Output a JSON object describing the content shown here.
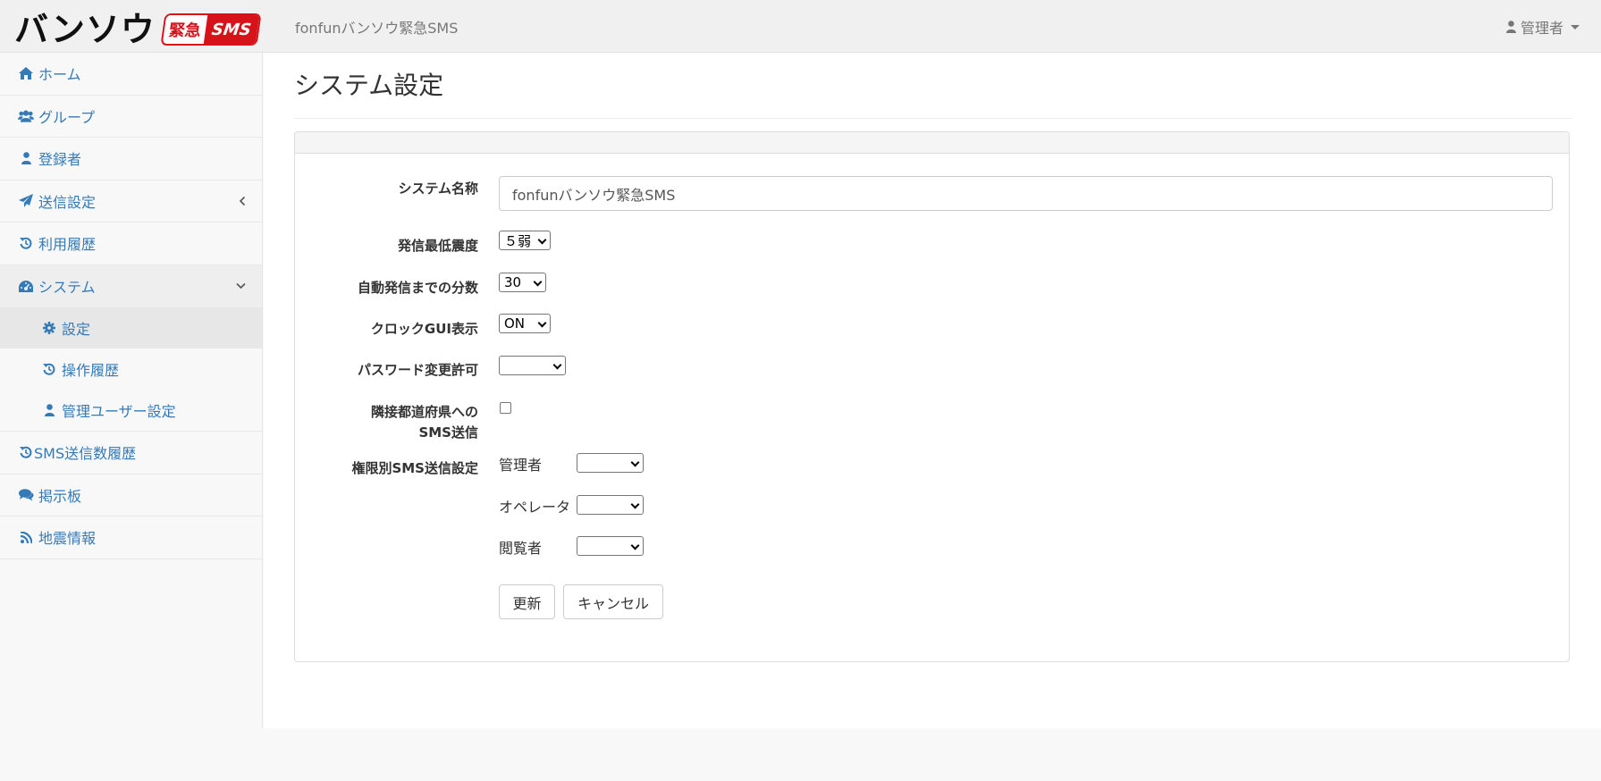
{
  "logo": {
    "text": "バンソウ",
    "badge_kanji": "緊急",
    "badge_sms": "SMS"
  },
  "header": {
    "app_title": "fonfunバンソウ緊急SMS",
    "user_label": "管理者"
  },
  "sidebar": {
    "items": [
      {
        "label": "ホーム",
        "icon": "home-icon"
      },
      {
        "label": "グループ",
        "icon": "users-icon"
      },
      {
        "label": "登録者",
        "icon": "user-icon"
      },
      {
        "label": "送信設定",
        "icon": "paper-plane-icon"
      },
      {
        "label": "利用履歴",
        "icon": "history-icon"
      },
      {
        "label": "システム",
        "icon": "dashboard-icon"
      },
      {
        "label": "SMS送信数履歴",
        "icon": "history-icon"
      },
      {
        "label": "掲示板",
        "icon": "comments-icon"
      },
      {
        "label": "地震情報",
        "icon": "rss-icon"
      }
    ],
    "system_sub": [
      {
        "label": "設定",
        "icon": "gear-icon"
      },
      {
        "label": "操作履歴",
        "icon": "history-icon"
      },
      {
        "label": "管理ユーザー設定",
        "icon": "user-icon"
      }
    ]
  },
  "page": {
    "title": "システム設定"
  },
  "form": {
    "system_name_label": "システム名称",
    "system_name_value": "fonfunバンソウ緊急SMS",
    "min_intensity_label": "発信最低震度",
    "min_intensity_value": "５弱",
    "auto_minutes_label": "自動発信までの分数",
    "auto_minutes_value": "30",
    "clock_gui_label": "クロックGUI表示",
    "clock_gui_value": "ON",
    "password_change_label": "パスワード変更許可",
    "password_change_value": "",
    "adjacent_label_line1": "隣接都道府県への",
    "adjacent_label_line2": "SMS送信",
    "adjacent_checked": false,
    "role_sms_label": "権限別SMS送信設定",
    "roles": [
      {
        "label": "管理者",
        "value": ""
      },
      {
        "label": "オペレータ",
        "value": ""
      },
      {
        "label": "閲覧者",
        "value": ""
      }
    ],
    "update_button": "更新",
    "cancel_button": "キャンセル"
  }
}
